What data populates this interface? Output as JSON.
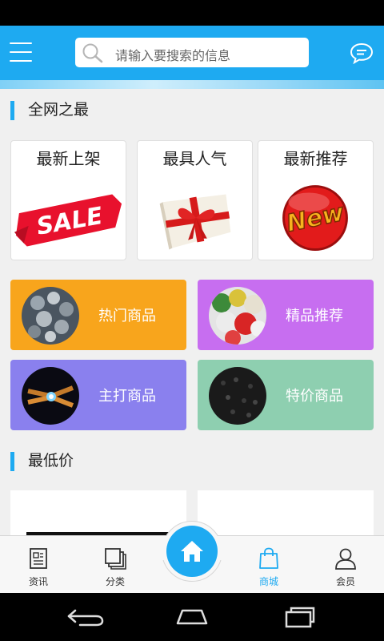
{
  "header": {
    "search_placeholder": "请输入要搜索的信息",
    "menu_icon": "hamburger-menu-icon",
    "search_icon": "search-icon",
    "message_icon": "chat-bubble-icon",
    "accent_color": "#1eaaf1"
  },
  "section_best": {
    "title": "全网之最",
    "cards": [
      {
        "label": "最新上架",
        "art": "sale-tag"
      },
      {
        "label": "最具人气",
        "art": "gift-box"
      },
      {
        "label": "最新推荐",
        "art": "new-badge"
      }
    ]
  },
  "categories": [
    {
      "label": "热门商品",
      "color": "#f8a51c"
    },
    {
      "label": "精品推荐",
      "color": "#c76ef0"
    },
    {
      "label": "主打商品",
      "color": "#8a80ee"
    },
    {
      "label": "特价商品",
      "color": "#8ecfb0"
    }
  ],
  "section_lowprice": {
    "title": "最低价"
  },
  "bottom_nav": {
    "items": [
      {
        "label": "资讯",
        "icon": "news-icon"
      },
      {
        "label": "分类",
        "icon": "category-icon"
      },
      {
        "label": "",
        "icon": "home-icon"
      },
      {
        "label": "商城",
        "icon": "shopping-bag-icon"
      },
      {
        "label": "会员",
        "icon": "user-icon"
      }
    ],
    "active_label": "商城"
  }
}
